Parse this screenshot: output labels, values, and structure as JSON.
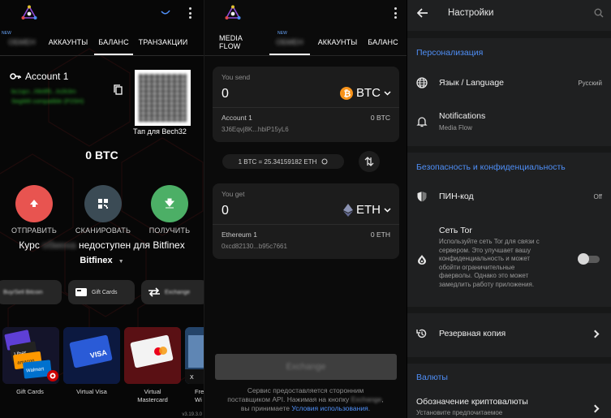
{
  "wallet": {
    "tabs": [
      {
        "label": "",
        "badge": "NEW",
        "obscured": "ОБМЕН"
      },
      {
        "label": "АККАУНТЫ"
      },
      {
        "label": "БАЛАНС"
      },
      {
        "label": "ТРАНЗАКЦИИ"
      }
    ],
    "account_name": "Account 1",
    "address_obscured": "bc1qcr...hfe9f5...ln2k3m",
    "address_type_obscured": "SegWit compatible (P2SH)",
    "qr_caption": "Тап для Bech32",
    "balance": "0 BTC",
    "actions": [
      {
        "label": "ОТПРАВИТЬ",
        "color": "#e85450",
        "icon": "send-icon"
      },
      {
        "label": "СКАНИРОВАТЬ",
        "color": "#3b4b55",
        "icon": "qr-scan-icon"
      },
      {
        "label": "ПОЛУЧИТЬ",
        "color": "#4caf66",
        "icon": "receive-icon"
      }
    ],
    "rate_prefix": "Курс",
    "rate_obscured": "обмена",
    "rate_suffix": "недоступен для Bitfinex",
    "rate_source": "Bitfinex",
    "pills": [
      {
        "label": "Buy/Sell Bitcoin",
        "obscured": true
      },
      {
        "label": "Gift Cards",
        "obscured": false
      },
      {
        "label": "Exchange",
        "obscured": true
      }
    ],
    "cards": [
      {
        "label": "Gift Cards"
      },
      {
        "label": "Virtual Visa"
      },
      {
        "label": "Virtual Mastercard"
      },
      {
        "label": "Fre Wi"
      }
    ],
    "version": "v3.19.3.0"
  },
  "exchange": {
    "tabs": [
      {
        "label": "MEDIA FLOW"
      },
      {
        "label": "",
        "badge": "NEW",
        "obscured": "ОБМЕН"
      },
      {
        "label": "АККАУНТЫ"
      },
      {
        "label": "БАЛАНС"
      }
    ],
    "send_label": "You send",
    "send_amount": "0",
    "send_coin": "BTC",
    "send_account": "Account 1",
    "send_balance": "0 BTC",
    "send_address": "3J6Eqvj8K...hbiP15yL6",
    "rate": "1 BTC = 25.34159182 ETH",
    "get_label": "You get",
    "get_amount": "0",
    "get_coin": "ETH",
    "get_account": "Ethereum 1",
    "get_balance": "0 ETH",
    "get_address": "0xcd82130...b95c7661",
    "button": "Exchange",
    "tos_line1": "Сервис предоставляется сторонним",
    "tos_line2a": "поставщиком API. Нажимая на кнопку",
    "tos_line2b": "Exchange",
    "tos_line2c": ",",
    "tos_line3a": "вы принимаете",
    "tos_link": "Условия использования",
    "tos_line3b": ".",
    "colors": {
      "btc": "#f7931a",
      "eth": "#8a92b2"
    }
  },
  "settings": {
    "title": "Настройки",
    "sections": {
      "personalization": "Персонализация",
      "security": "Безопасность и конфиденциальность",
      "currencies": "Валюты"
    },
    "language_label": "Язык / Language",
    "language_value": "Русский",
    "notifications_label": "Notifications",
    "notifications_sub": "Media Flow",
    "pin_label": "ПИН-код",
    "pin_value": "Off",
    "tor_label": "Сеть Tor",
    "tor_desc_1": "Используйте сеть Tor для связи с",
    "tor_desc_2": "сервером. Это улучшает вашу",
    "tor_desc_3": "конфиденциальность и может",
    "tor_desc_4": "обойти ограничительные",
    "tor_desc_5": "фаерволы. Однако это может",
    "tor_desc_6": "замедлить работу приложения.",
    "tor_enabled": false,
    "backup_label": "Резервная копия",
    "crypto_label": "Обозначение криптовалюты",
    "crypto_sub": "Установите предпочитаемое",
    "accent": "#4f8ff7"
  }
}
